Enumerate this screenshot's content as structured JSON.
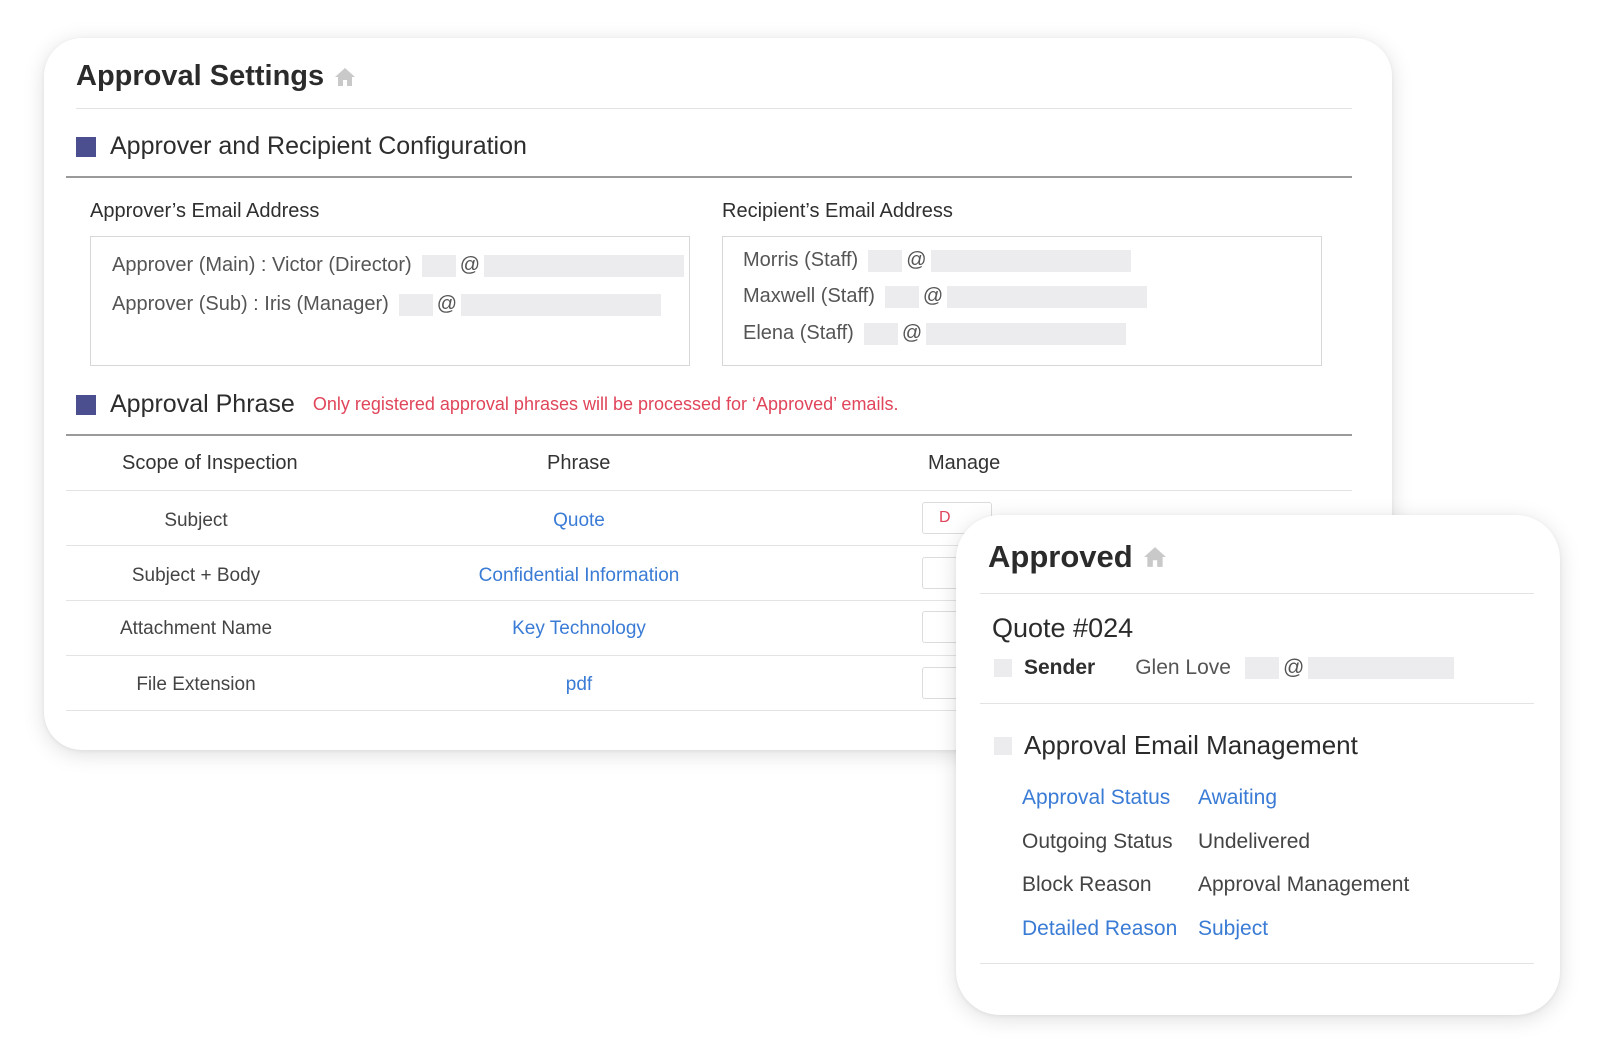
{
  "settings": {
    "title": "Approval Settings",
    "config_section": "Approver and Recipient Configuration",
    "approver_label": "Approver’s Email Address",
    "recipient_label": "Recipient’s Email Address",
    "approvers": [
      {
        "name": "Approver (Main) : Victor (Director)",
        "at": "@"
      },
      {
        "name": "Approver (Sub) : Iris (Manager)",
        "at": "@"
      }
    ],
    "recipients": [
      {
        "name": "Morris (Staff)",
        "at": "@"
      },
      {
        "name": "Maxwell (Staff)",
        "at": "@"
      },
      {
        "name": "Elena (Staff)",
        "at": "@"
      }
    ],
    "phrase_section": "Approval Phrase",
    "phrase_note": "Only registered approval phrases will be processed for ‘Approved’ emails.",
    "table": {
      "headers": [
        "Scope of Inspection",
        "Phrase",
        "Manage"
      ],
      "rows": [
        {
          "scope": "Subject",
          "phrase": "Quote",
          "manage": "D"
        },
        {
          "scope": "Subject + Body",
          "phrase": "Confidential Information",
          "manage": ""
        },
        {
          "scope": "Attachment Name",
          "phrase": "Key Technology",
          "manage": ""
        },
        {
          "scope": "File Extension",
          "phrase": "pdf",
          "manage": ""
        }
      ]
    }
  },
  "approved": {
    "title": "Approved",
    "quote": "Quote #024",
    "sender_label": "Sender",
    "sender_name": "Glen Love",
    "sender_at": "@",
    "mgmt_section": "Approval Email Management",
    "rows": [
      {
        "label": "Approval Status",
        "value": "Awaiting"
      },
      {
        "label": "Outgoing Status",
        "value": "Undelivered"
      },
      {
        "label": "Block Reason",
        "value": "Approval Management"
      },
      {
        "label": "Detailed Reason",
        "value": "Subject"
      }
    ]
  },
  "colors": {
    "accent_square": "#4b4f8f",
    "link_blue": "#3a7bd5",
    "warning_red": "#e0455a"
  },
  "icons": [
    "home-icon"
  ]
}
